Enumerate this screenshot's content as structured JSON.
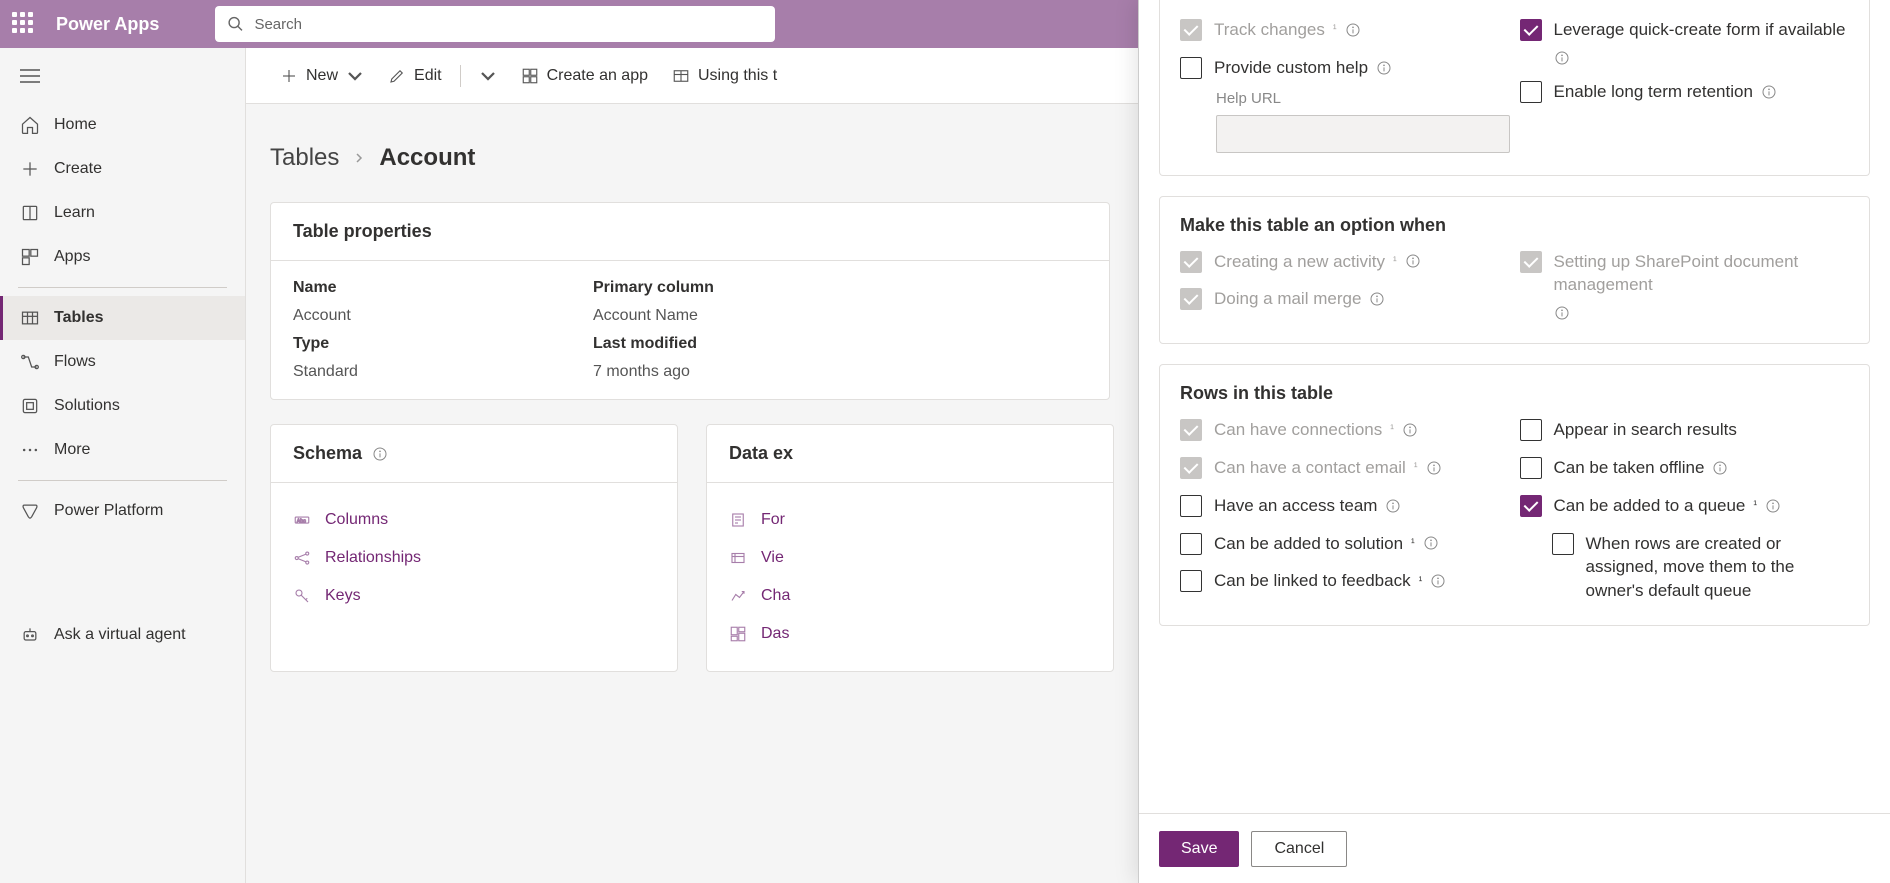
{
  "header": {
    "app_name": "Power Apps",
    "search_placeholder": "Search"
  },
  "sidebar": {
    "items": [
      {
        "label": "Home",
        "icon": "home"
      },
      {
        "label": "Create",
        "icon": "plus"
      },
      {
        "label": "Learn",
        "icon": "book"
      },
      {
        "label": "Apps",
        "icon": "apps"
      },
      {
        "label": "Tables",
        "icon": "table",
        "active": true
      },
      {
        "label": "Flows",
        "icon": "flow"
      },
      {
        "label": "Solutions",
        "icon": "solution"
      },
      {
        "label": "More",
        "icon": "more"
      },
      {
        "label": "Power Platform",
        "icon": "pp"
      },
      {
        "label": "Ask a virtual agent",
        "icon": "bot"
      }
    ]
  },
  "commands": {
    "new": "New",
    "edit": "Edit",
    "create_app": "Create an app",
    "using_this_table": "Using this t"
  },
  "breadcrumb": {
    "root": "Tables",
    "current": "Account"
  },
  "table_properties": {
    "title": "Table properties",
    "labels": {
      "name": "Name",
      "primary": "Primary column",
      "type": "Type",
      "modified": "Last modified"
    },
    "values": {
      "name": "Account",
      "primary": "Account Name",
      "type": "Standard",
      "modified": "7 months ago"
    }
  },
  "schema": {
    "title": "Schema",
    "columns": "Columns",
    "relationships": "Relationships",
    "keys": "Keys"
  },
  "data": {
    "title": "Data ex",
    "forms": "For",
    "views": "Vie",
    "charts": "Cha",
    "dashboards": "Das"
  },
  "panel": {
    "section1": {
      "track_changes": "Track changes",
      "provide_help": "Provide custom help",
      "help_url_label": "Help URL",
      "leverage_quick_create": "Leverage quick-create form if available",
      "long_term_retention": "Enable long term retention"
    },
    "section2": {
      "title": "Make this table an option when",
      "creating_activity": "Creating a new activity",
      "mail_merge": "Doing a mail merge",
      "sharepoint": "Setting up SharePoint document management"
    },
    "section3": {
      "title": "Rows in this table",
      "connections": "Can have connections",
      "contact_email": "Can have a contact email",
      "access_team": "Have an access team",
      "added_to_solution": "Can be added to solution",
      "linked_feedback": "Can be linked to feedback",
      "search_results": "Appear in search results",
      "taken_offline": "Can be taken offline",
      "added_to_queue": "Can be added to a queue",
      "move_to_owner_queue": "When rows are created or assigned, move them to the owner's default queue"
    },
    "footnote": "¹",
    "buttons": {
      "save": "Save",
      "cancel": "Cancel"
    }
  }
}
